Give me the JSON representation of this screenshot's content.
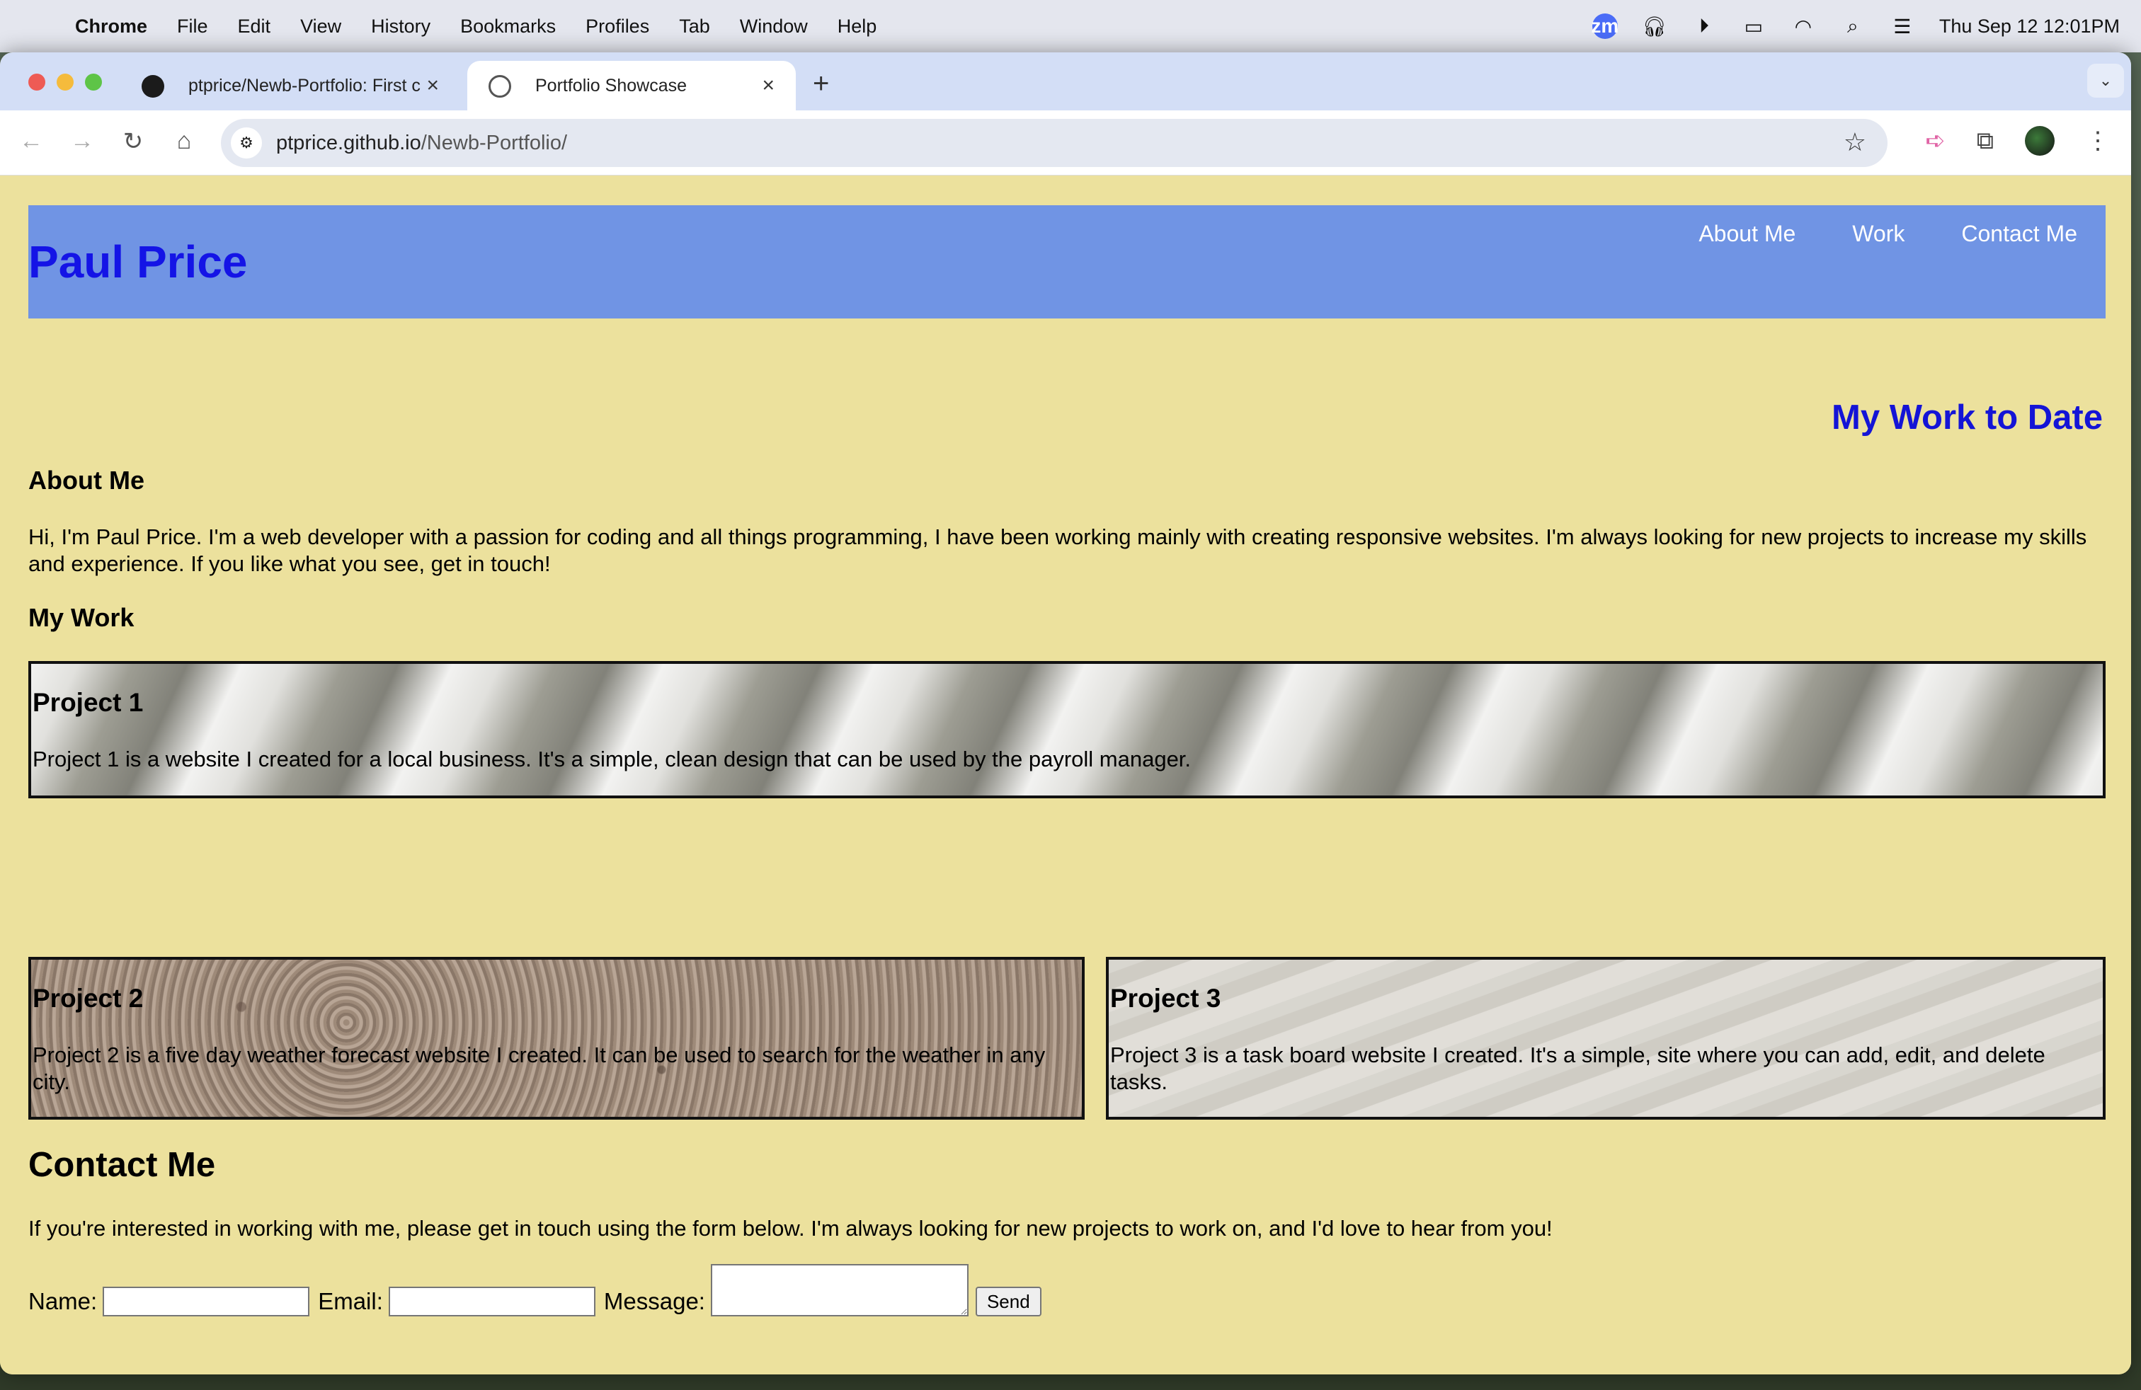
{
  "menubar": {
    "app": "Chrome",
    "items": [
      "File",
      "Edit",
      "View",
      "History",
      "Bookmarks",
      "Profiles",
      "Tab",
      "Window",
      "Help"
    ],
    "clock": "Thu Sep 12  12:01PM",
    "zoom_badge": "zm"
  },
  "browser": {
    "tabs": [
      {
        "title": "ptprice/Newb-Portfolio: First c"
      },
      {
        "title": "Portfolio Showcase"
      }
    ],
    "url_host": "ptprice.github.io",
    "url_path": "/Newb-Portfolio/"
  },
  "site": {
    "title": "Paul Price",
    "nav": [
      "About Me",
      "Work",
      "Contact Me"
    ],
    "work_heading": "My Work to Date",
    "about_heading": "About Me",
    "about_text": "Hi, I'm Paul Price. I'm a web developer with a passion for coding and all things programming, I have been working mainly with creating responsive websites. I'm always looking for new projects to increase my skills and experience. If you like what you see, get in touch!",
    "work_section_heading": "My Work",
    "projects": [
      {
        "title": "Project 1",
        "description": "Project 1 is a website I created for a local business. It's a simple, clean design that can be used by the payroll manager."
      },
      {
        "title": "Project 2",
        "description": "Project 2 is a five day weather forecast website I created. It can be used to search for the weather in any city."
      },
      {
        "title": "Project 3",
        "description": "Project 3 is a task board website I created. It's a simple, site where you can add, edit, and delete tasks."
      }
    ],
    "contact_heading": "Contact Me",
    "contact_text": "If you're interested in working with me, please get in touch using the form below. I'm always looking for new projects to work on, and I'd love to hear from you!",
    "form": {
      "name_label": "Name:",
      "email_label": "Email:",
      "message_label": "Message:",
      "send_label": "Send"
    }
  },
  "colors": {
    "page_bg": "#ece19d",
    "header_bg": "#7094e4",
    "title_blue": "#1414e6"
  }
}
